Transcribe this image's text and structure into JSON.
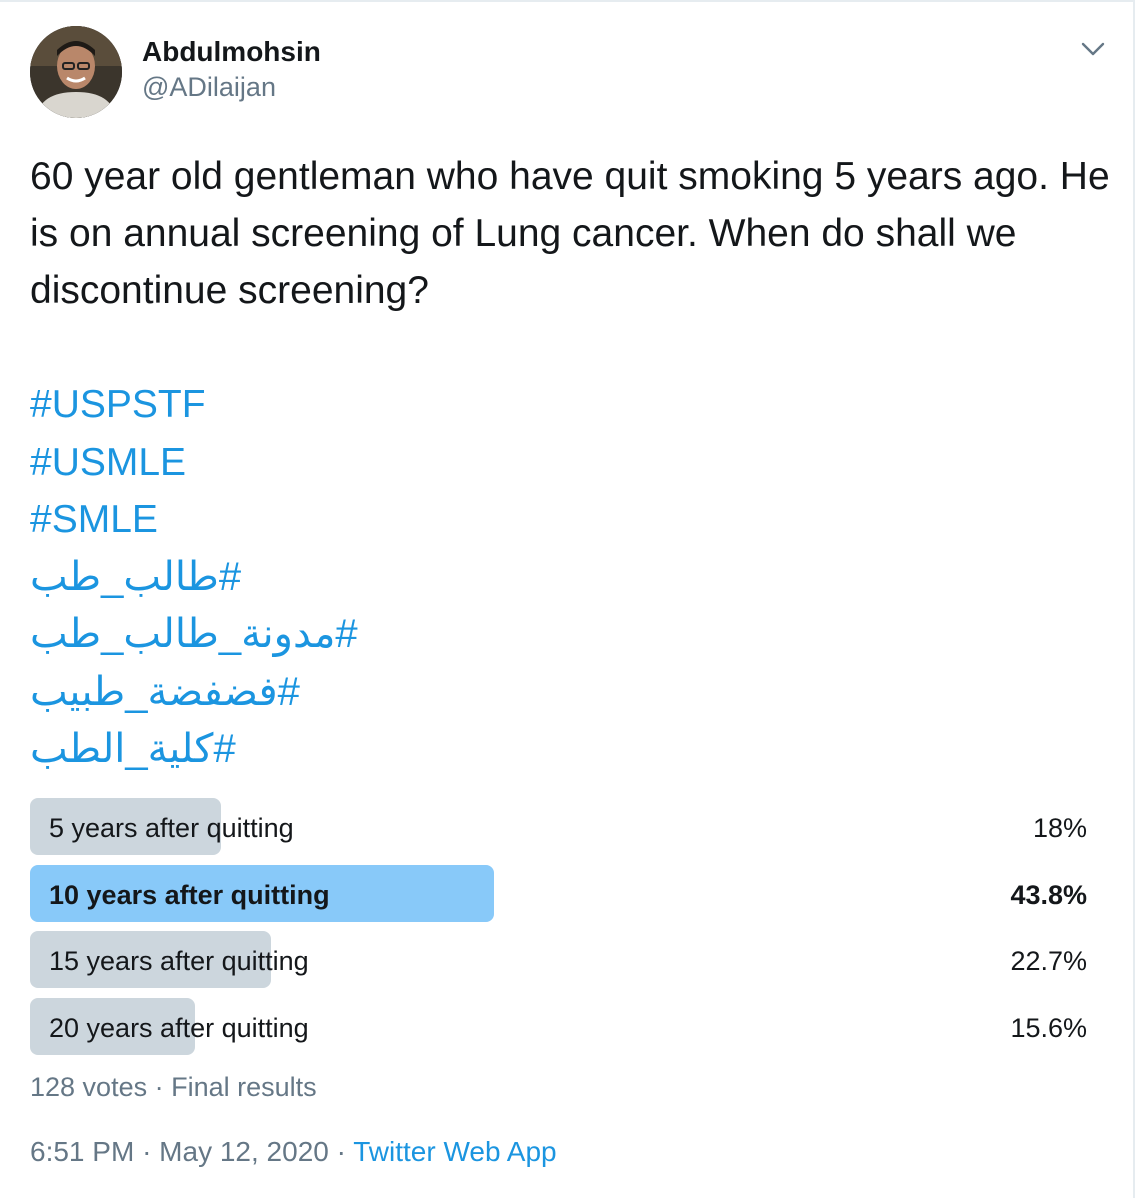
{
  "author": {
    "display_name": "Abdulmohsin",
    "handle": "@ADilaijan"
  },
  "tweet": {
    "text": "60 year old gentleman who have quit smoking 5 years ago. He is on annual screening of Lung cancer. When do shall we discontinue screening?",
    "hashtags": [
      "#USPSTF",
      "#USMLE",
      "#SMLE",
      "#طالب_طب",
      "#مدونة_طالب_طب",
      "#فضفضة_طبيب",
      "#كلية_الطب"
    ]
  },
  "poll": {
    "options": [
      {
        "label": "5 years after quitting",
        "percent_text": "18%",
        "percent": 18,
        "winner": false
      },
      {
        "label": "10 years after quitting",
        "percent_text": "43.8%",
        "percent": 43.8,
        "winner": true
      },
      {
        "label": "15 years after quitting",
        "percent_text": "22.7%",
        "percent": 22.7,
        "winner": false
      },
      {
        "label": "20 years after quitting",
        "percent_text": "15.6%",
        "percent": 15.6,
        "winner": false
      }
    ],
    "votes": "128 votes",
    "status": "Final results",
    "bar_color": "#ccd6dd",
    "winner_color": "#88c9f9"
  },
  "footer": {
    "time": "6:51 PM",
    "date": "May 12, 2020",
    "source": "Twitter Web App"
  },
  "colors": {
    "link": "#1b95e0",
    "muted": "#657786",
    "text": "#14171a"
  },
  "icons": {
    "menu": "chevron-down-icon",
    "avatar": "user-avatar"
  }
}
